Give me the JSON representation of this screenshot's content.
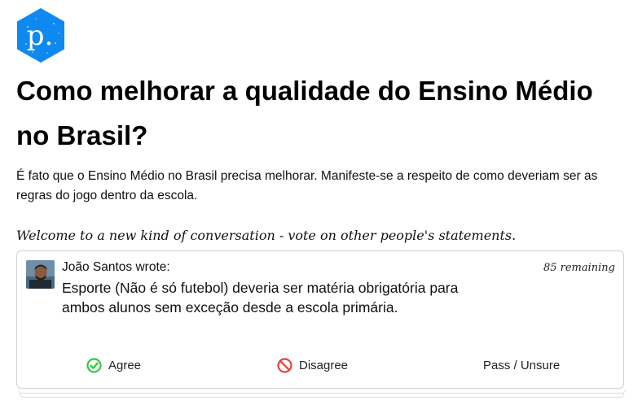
{
  "logo": {
    "letter": "p.",
    "color": "#0e89f0",
    "icon": "polis-logo-icon"
  },
  "conversation": {
    "title": "Como melhorar a qualidade do Ensino Médio no Brasil?",
    "description": "É fato que o Ensino Médio no Brasil precisa melhorar. Manifeste-se a respeito de como deveriam ser as regras do jogo dentro da escola.",
    "welcome": "Welcome to a new kind of conversation - vote on other people's statements."
  },
  "statement_card": {
    "author": "João Santos wrote:",
    "remaining": "85 remaining",
    "text": "Esporte (Não é só futebol) deveria ser matéria obrigatória para ambos alunos sem exceção desde a escola primária.",
    "avatar_icon": "user-avatar-photo"
  },
  "votes": {
    "agree": {
      "label": "Agree",
      "icon": "check-circle-icon",
      "color": "#2ecc40"
    },
    "disagree": {
      "label": "Disagree",
      "icon": "ban-circle-icon",
      "color": "#e8423a"
    },
    "pass": {
      "label": "Pass / Unsure"
    }
  }
}
